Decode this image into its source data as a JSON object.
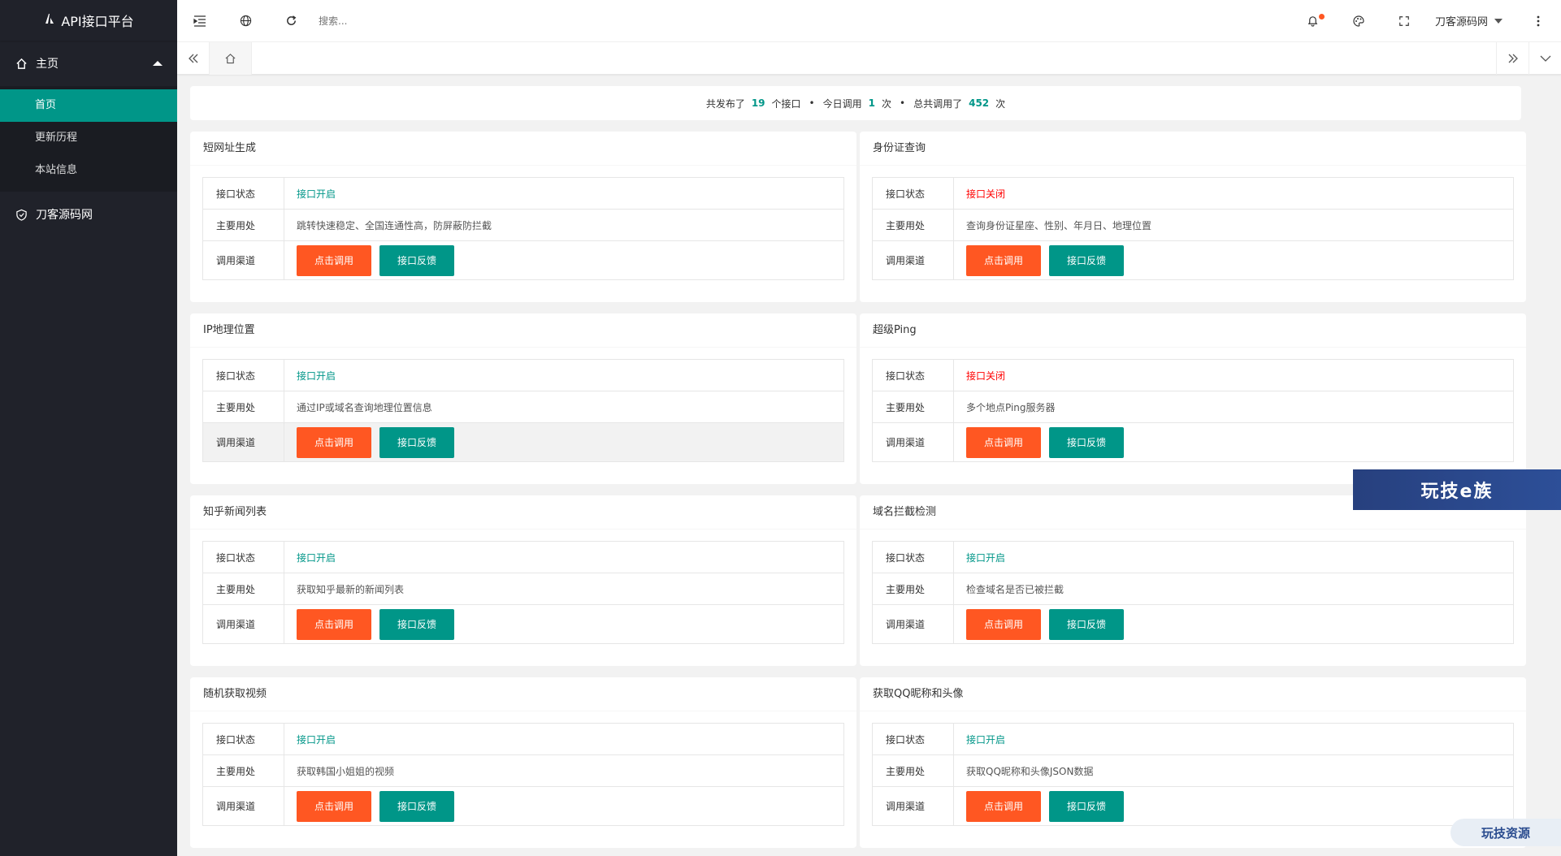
{
  "app": {
    "title": "API接口平台"
  },
  "sidebar": {
    "group_main": "主页",
    "items": [
      "首页",
      "更新历程",
      "本站信息"
    ],
    "group_site": "刀客源码网"
  },
  "header": {
    "search_placeholder": "搜索...",
    "user": "刀客源码网"
  },
  "stats": {
    "prefix": "共发布了",
    "published": "19",
    "published_unit": "个接口",
    "today_label": "今日调用",
    "today": "1",
    "today_unit": "次",
    "total_label": "总共调用了",
    "total": "452",
    "total_unit": "次",
    "sep": "•"
  },
  "labels": {
    "status": "接口状态",
    "usage": "主要用处",
    "channel": "调用渠道",
    "call_btn": "点击调用",
    "feedback_btn": "接口反馈"
  },
  "cards": [
    {
      "title": "短网址生成",
      "status": "接口开启",
      "usage": "跳转快速稳定、全国连通性高，防屏蔽防拦截"
    },
    {
      "title": "身份证查询",
      "status": "接口关闭",
      "usage": "查询身份证星座、性别、年月日、地理位置"
    },
    {
      "title": "IP地理位置",
      "status": "接口开启",
      "usage": "通过IP或域名查询地理位置信息"
    },
    {
      "title": "超级Ping",
      "status": "接口关闭",
      "usage": "多个地点Ping服务器"
    },
    {
      "title": "知乎新闻列表",
      "status": "接口开启",
      "usage": "获取知乎最新的新闻列表"
    },
    {
      "title": "域名拦截检测",
      "status": "接口开启",
      "usage": "检查域名是否已被拦截"
    },
    {
      "title": "随机获取视频",
      "status": "接口开启",
      "usage": "获取韩国小姐姐的视频"
    },
    {
      "title": "获取QQ昵称和头像",
      "status": "接口开启",
      "usage": "获取QQ昵称和头像JSON数据"
    }
  ],
  "watermarks": {
    "top": "玩技e族",
    "bottom": "玩技资源"
  },
  "colors": {
    "accent": "#009688",
    "danger": "#ff5722",
    "sidebar": "#20222a",
    "status_off": "#ff0000"
  }
}
